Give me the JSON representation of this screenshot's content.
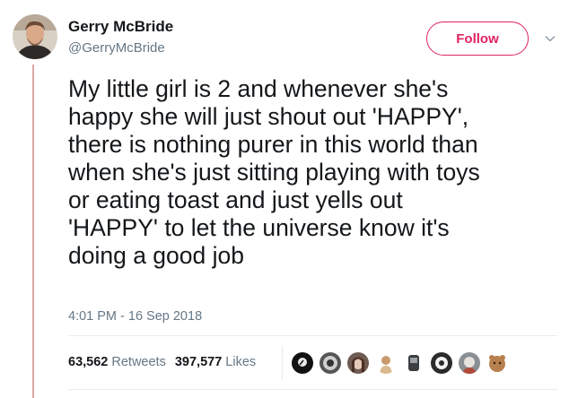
{
  "author": {
    "name": "Gerry McBride",
    "handle": "@GerryMcBride"
  },
  "follow_label": "Follow",
  "tweet": {
    "text": "My little girl is 2 and whenever she's\nhappy she will just shout out 'HAPPY',\nthere is nothing purer in this world than\nwhen she's just sitting playing with toys\nor eating toast and just yells out\n'HAPPY' to let the universe know it's\ndoing a good job",
    "timestamp": "4:01 PM - 16 Sep 2018"
  },
  "stats": {
    "retweets_count": "63,562",
    "retweets_label": "Retweets",
    "likes_count": "397,577",
    "likes_label": "Likes"
  },
  "colors": {
    "follow_accent": "#e0245e",
    "secondary_text": "#657786",
    "thread_line": "#e0a7a7"
  }
}
